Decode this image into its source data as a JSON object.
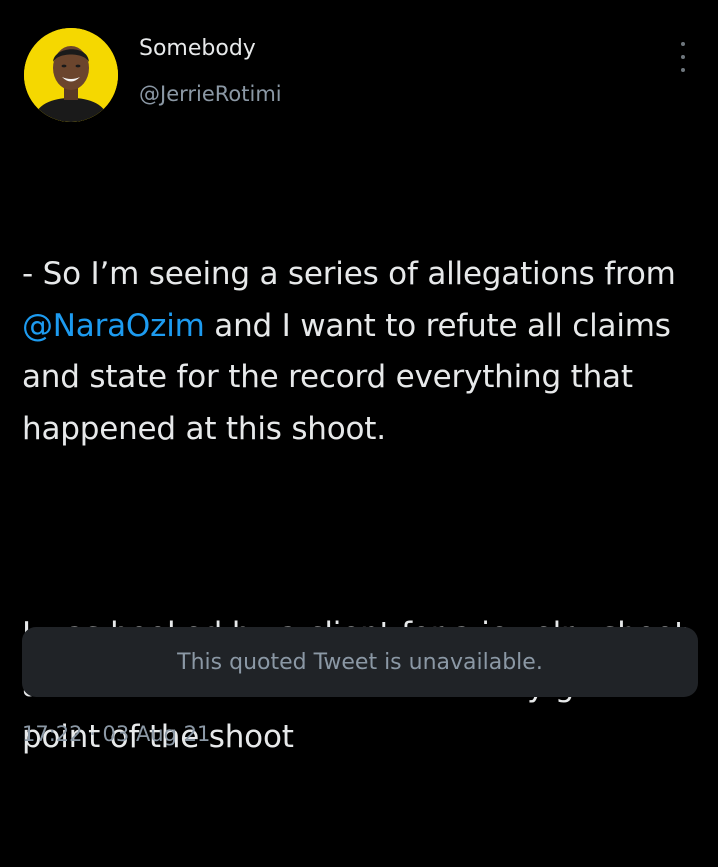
{
  "author": {
    "display_name": "Somebody",
    "handle": "@JerrieRotimi",
    "avatar_icon": "avatar-photo",
    "avatar_bg": "#f5d800"
  },
  "tweet": {
    "p1_before": "- So I’m seeing a series of allegations from ",
    "mention": "@NaraOzim",
    "p1_after": " and I want to refute all claims and state for the record everything that happened at this shoot.",
    "p2": "I was booked by a client for a jewelry shoot and Nara was the model. At every given point of the shoot"
  },
  "quoted_tweet": {
    "text": "This quoted Tweet is unavailable."
  },
  "meta": {
    "timestamp": "17:22 · 03 Aug 21"
  },
  "colors": {
    "background": "#000000",
    "text": "#e7e9ea",
    "secondary": "#8b98a5",
    "link": "#1d9bf0",
    "card": "#202327"
  }
}
